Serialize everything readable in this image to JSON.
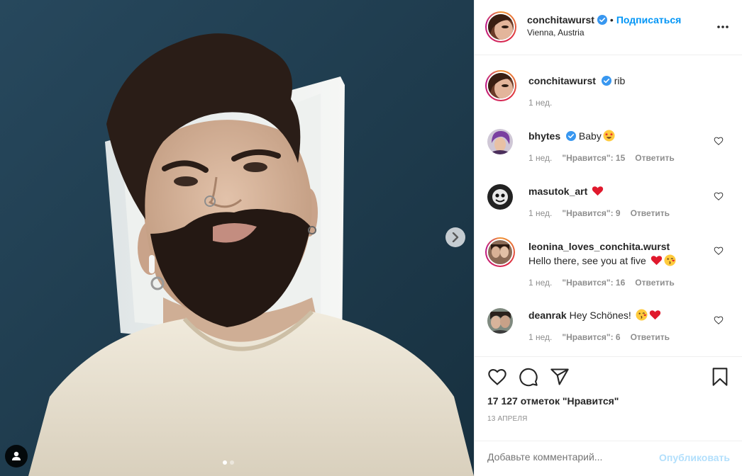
{
  "post": {
    "author": "conchitawurst",
    "follow_label": "Подписаться",
    "bullet": "•",
    "location": "Vienna, Austria"
  },
  "caption": {
    "username": "conchitawurst",
    "text": "rib",
    "time": "1 нед."
  },
  "comments": [
    {
      "username": "bhytes",
      "verified": true,
      "text": "Baby",
      "emoji": [
        "star-struck-emoji"
      ],
      "time": "1 нед.",
      "likes": "\"Нравится\": 15",
      "reply": "Ответить"
    },
    {
      "username": "masutok_art",
      "verified": false,
      "text": "",
      "emoji": [
        "red-heart-emoji"
      ],
      "time": "1 нед.",
      "likes": "\"Нравится\": 9",
      "reply": "Ответить"
    },
    {
      "username": "leonina_loves_conchita.wurst",
      "verified": false,
      "text": "Hello there, see you at five",
      "emoji": [
        "red-heart-emoji",
        "kissing-face-emoji"
      ],
      "time": "1 нед.",
      "likes": "\"Нравится\": 16",
      "reply": "Ответить"
    },
    {
      "username": "deanrak",
      "verified": false,
      "text": "Hey Schönes!",
      "emoji": [
        "kissing-face-emoji",
        "red-heart-emoji"
      ],
      "time": "1 нед.",
      "likes": "\"Нравится\": 6",
      "reply": "Ответить"
    }
  ],
  "stats": {
    "likes": "17 127 отметок \"Нравится\"",
    "date": "13 апреля"
  },
  "composer": {
    "placeholder": "Добавьте комментарий...",
    "publish_label": "Опубликовать"
  },
  "carousel": {
    "current": 1,
    "total": 2
  },
  "colors": {
    "accent": "#0095f6",
    "publish_disabled": "#b2dffc",
    "meta_text": "#8e8e8e",
    "verified": "#3897f0"
  },
  "icons": [
    "verified-badge-icon",
    "more-options-icon",
    "heart-icon",
    "comment-icon",
    "share-icon",
    "bookmark-icon",
    "chevron-right-icon",
    "user-tag-icon"
  ]
}
